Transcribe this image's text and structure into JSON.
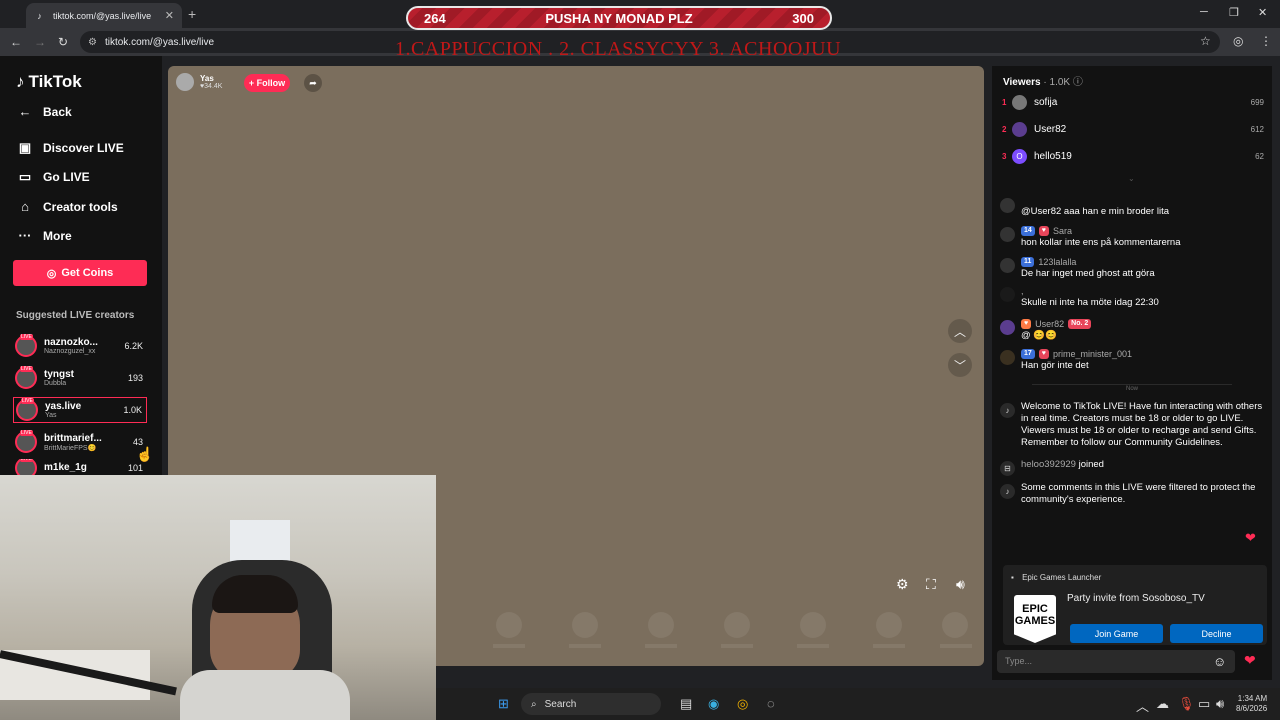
{
  "browser": {
    "tab_title": "tiktok.com/@yas.live/live",
    "url": "tiktok.com/@yas.live/live"
  },
  "overlay": {
    "goal_left": "264",
    "goal_title": "PUSHA NY MONAD PLZ",
    "goal_right": "300",
    "ranking_note": "1.CAPPUCCION . 2. CLASSYCYY 3. ACHOOJUU"
  },
  "sidebar": {
    "logo": "TikTok",
    "back": "Back",
    "nav": [
      "Discover LIVE",
      "Go LIVE",
      "Creator tools",
      "More"
    ],
    "get_coins": "Get Coins",
    "suggested_header": "Suggested LIVE creators",
    "creators": [
      {
        "name": "naznozko...",
        "handle": "Naznozguzel_xx",
        "count": "6.2K"
      },
      {
        "name": "tyngst",
        "handle": "Dubbla",
        "count": "193"
      },
      {
        "name": "yas.live",
        "handle": "Yas",
        "count": "1.0K"
      },
      {
        "name": "brittmarief...",
        "handle": "BrittMarieFPS😊",
        "count": "43"
      },
      {
        "name": "m1ke_1g",
        "handle": "",
        "count": "101"
      }
    ]
  },
  "video": {
    "host_name": "Yas",
    "host_likes": "♥34.4K",
    "follow": "+ Follow"
  },
  "viewers": {
    "label": "Viewers",
    "count": "· 1.0K",
    "top": [
      {
        "rank": "1",
        "name": "sofija",
        "score": "699"
      },
      {
        "rank": "2",
        "name": "User82",
        "score": "612"
      },
      {
        "rank": "3",
        "name": "hello519",
        "score": "62",
        "initial": "O"
      }
    ]
  },
  "chat": [
    {
      "user": "",
      "badges": [],
      "text": "@User82 aaa han e min broder lita"
    },
    {
      "user": "Sara",
      "badges": [
        "14"
      ],
      "text": "hon kollar inte ens på kommentarerna"
    },
    {
      "user": "123lalalla",
      "badges": [
        "11"
      ],
      "text": "De har inget med ghost att göra"
    },
    {
      "user": ",",
      "badges": [],
      "text": "Skulle ni inte ha möte idag 22:30"
    },
    {
      "user": "User82",
      "badges": [
        "No. 2"
      ],
      "text": "@ 😊😊"
    },
    {
      "user": "prime_minister_001",
      "badges": [
        "17"
      ],
      "text": "Han gör inte det"
    }
  ],
  "now_label": "Now",
  "system_msgs": {
    "welcome": "Welcome to TikTok LIVE! Have fun interacting with others in real time. Creators must be 18 or older to go LIVE. Viewers must be 18 or older to recharge and send Gifts. Remember to follow our Community Guidelines.",
    "joined_user": "heloo392929",
    "joined_text": "joined",
    "filtered": "Some comments in this LIVE were filtered to protect the community's experience."
  },
  "toast": {
    "app": "Epic Games Launcher",
    "logo": "EPIC GAMES",
    "message": "Party invite from Sosoboso_TV",
    "join": "Join Game",
    "decline": "Decline"
  },
  "chat_input": {
    "placeholder": "Type..."
  },
  "taskbar": {
    "search": "Search",
    "time": "1:34 AM",
    "date": "8/6/2026"
  },
  "colors": {
    "accent": "#fe2c55",
    "goal_bar": "#b01d2a",
    "video_bg": "#7b6e5d"
  }
}
